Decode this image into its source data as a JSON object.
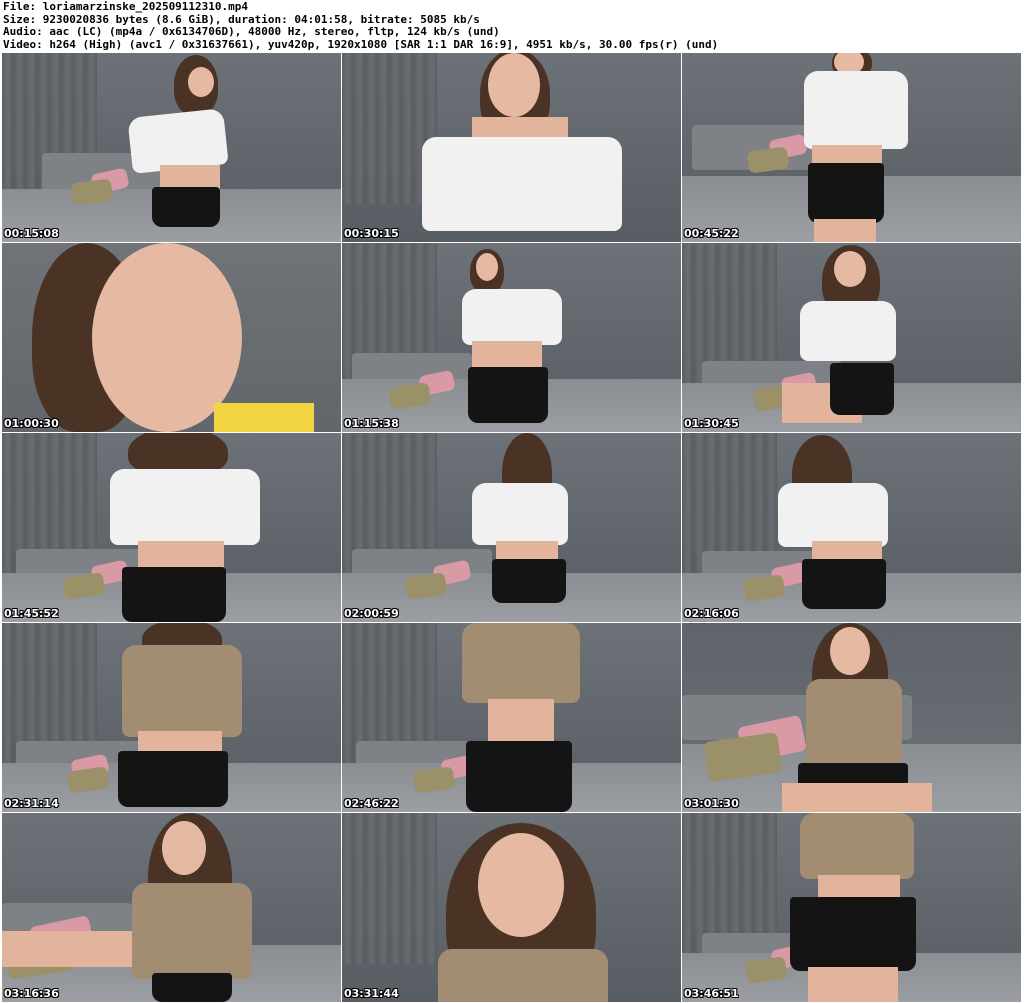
{
  "header": {
    "file_line": "File: loriamarzinske_202509112310.mp4",
    "size_line": "Size: 9230020836 bytes (8.6 GiB), duration: 04:01:58, bitrate: 5085 kb/s",
    "audio_line": "Audio: aac (LC) (mp4a / 0x6134706D), 48000 Hz, stereo, fltp, 124 kb/s (und)",
    "video_line": "Video: h264 (High) (avc1 / 0x31637661), yuv420p, 1920x1080 [SAR 1:1 DAR 16:9], 4951 kb/s, 30.00 fps(r) (und)"
  },
  "thumbnails": [
    {
      "timestamp": "00:15:08"
    },
    {
      "timestamp": "00:30:15"
    },
    {
      "timestamp": "00:45:22"
    },
    {
      "timestamp": "01:00:30"
    },
    {
      "timestamp": "01:15:38"
    },
    {
      "timestamp": "01:30:45"
    },
    {
      "timestamp": "01:45:52"
    },
    {
      "timestamp": "02:00:59"
    },
    {
      "timestamp": "02:16:06"
    },
    {
      "timestamp": "02:31:14"
    },
    {
      "timestamp": "02:46:22"
    },
    {
      "timestamp": "03:01:30"
    },
    {
      "timestamp": "03:16:36"
    },
    {
      "timestamp": "03:31:44"
    },
    {
      "timestamp": "03:46:51"
    }
  ],
  "colors": {
    "background": "#ffffff",
    "wall": "#666c72",
    "top_white": "#f1f1f1",
    "top_beige": "#a28c72",
    "shorts": "#141414",
    "hair": "#4a3325",
    "timestamp_text": "#ffffff"
  }
}
